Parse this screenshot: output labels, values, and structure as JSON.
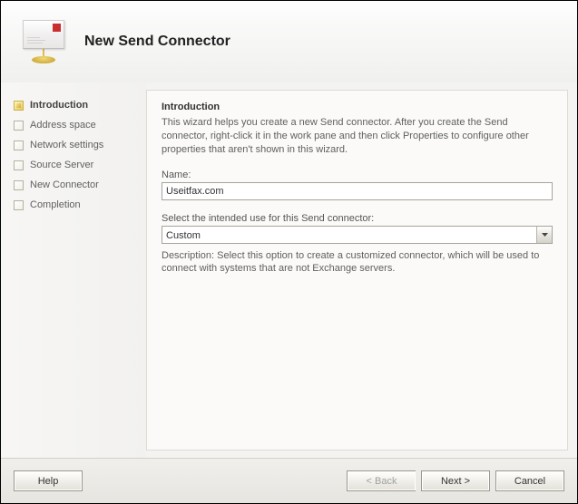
{
  "header": {
    "title": "New Send Connector"
  },
  "sidebar": {
    "steps": [
      {
        "label": "Introduction"
      },
      {
        "label": "Address space"
      },
      {
        "label": "Network settings"
      },
      {
        "label": "Source Server"
      },
      {
        "label": "New Connector"
      },
      {
        "label": "Completion"
      }
    ]
  },
  "content": {
    "title": "Introduction",
    "intro": "This wizard helps you create a new Send connector. After you create the Send connector, right-click it in the work pane and then click Properties to configure other properties that aren't shown in this wizard.",
    "name_label": "Name:",
    "name_value": "Useitfax.com",
    "use_label": "Select the intended use for this Send connector:",
    "use_value": "Custom",
    "description": "Description: Select this option to create a customized connector, which will be used to connect with systems that are not Exchange servers."
  },
  "footer": {
    "help": "Help",
    "back": "< Back",
    "next": "Next >",
    "cancel": "Cancel"
  }
}
